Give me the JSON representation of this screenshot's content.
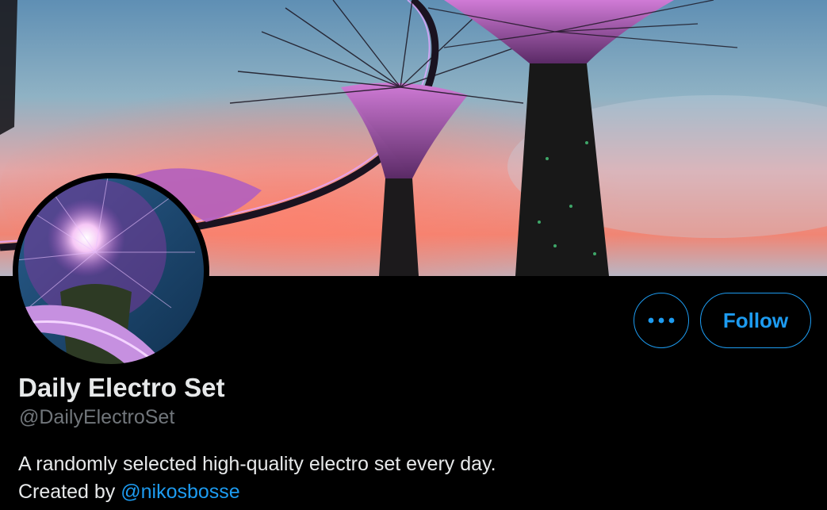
{
  "colors": {
    "background": "#000000",
    "accent": "#1d9bf0",
    "primary_text": "#e7e9ea",
    "secondary_text": "#71767b"
  },
  "banner": {
    "image": "supertree-grove-at-dusk-photo"
  },
  "avatar": {
    "image": "illuminated-supertree-photo"
  },
  "actions": {
    "more_icon": "more-horizontal-icon",
    "follow_label": "Follow"
  },
  "profile": {
    "display_name": "Daily Electro Set",
    "handle": "@DailyElectroSet",
    "bio_line1": "A randomly selected high-quality electro set every day.",
    "bio_line2_prefix": "Created by",
    "bio_mention": "@nikosbosse"
  }
}
